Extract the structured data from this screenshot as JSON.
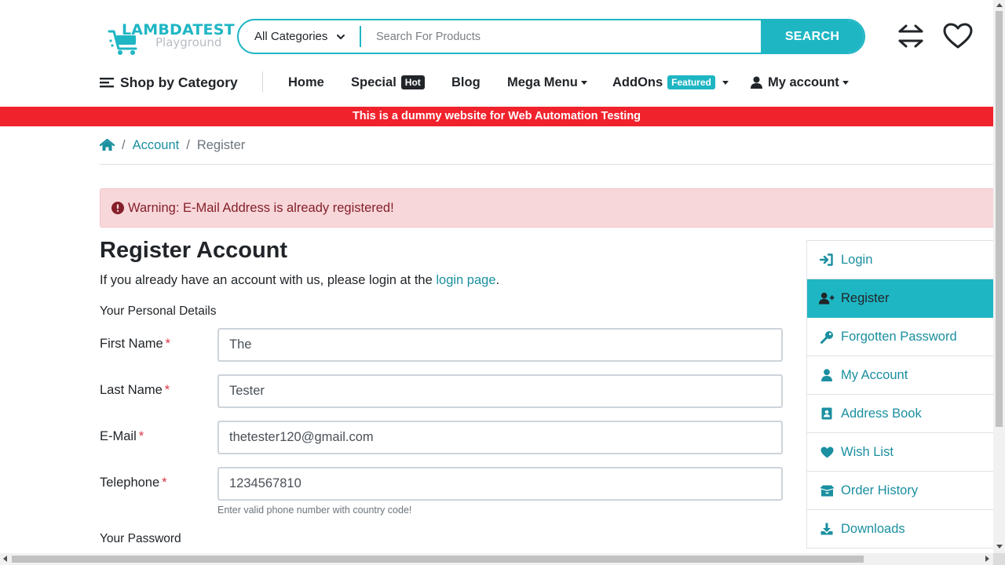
{
  "brand": {
    "name": "LAMBDATEST",
    "sub": "Playground"
  },
  "search": {
    "category": "All Categories",
    "placeholder": "Search For Products",
    "button": "SEARCH"
  },
  "header_icons": [
    "compare-icon",
    "wishlist-heart-icon"
  ],
  "nav": {
    "shop_by_category": "Shop by Category",
    "home": "Home",
    "special": "Special",
    "special_badge": "Hot",
    "blog": "Blog",
    "mega_menu": "Mega Menu",
    "addons": "AddOns",
    "addons_badge": "Featured",
    "my_account": "My account"
  },
  "colors": {
    "accent": "#1fb6c4",
    "banner": "#f0222c",
    "hot_badge": "#212529",
    "link": "#1a8fa0",
    "warning_bg": "#f8d7da",
    "warning_text": "#842029"
  },
  "banner": "This is a dummy website for Web Automation Testing",
  "breadcrumb": {
    "sep": "/",
    "account": "Account",
    "current": "Register"
  },
  "alert": "Warning: E-Mail Address is already registered!",
  "page": {
    "title": "Register Account",
    "intro_prefix": "If you already have an account with us, please login at the ",
    "intro_link": "login page",
    "intro_suffix": ".",
    "personal_legend": "Your Personal Details",
    "password_legend": "Your Password"
  },
  "form": {
    "required_mark": "*",
    "first_name": {
      "label": "First Name",
      "value": "The"
    },
    "last_name": {
      "label": "Last Name",
      "value": "Tester"
    },
    "email": {
      "label": "E-Mail",
      "value": "thetester120@gmail.com"
    },
    "telephone": {
      "label": "Telephone",
      "value": "1234567810",
      "help": "Enter valid phone number with country code!"
    }
  },
  "sidebar": {
    "items": [
      {
        "label": "Login",
        "icon": "sign-in-icon"
      },
      {
        "label": "Register",
        "icon": "user-plus-icon",
        "active": true
      },
      {
        "label": "Forgotten Password",
        "icon": "key-icon"
      },
      {
        "label": "My Account",
        "icon": "user-icon"
      },
      {
        "label": "Address Book",
        "icon": "address-book-icon"
      },
      {
        "label": "Wish List",
        "icon": "heart-icon"
      },
      {
        "label": "Order History",
        "icon": "order-history-icon"
      },
      {
        "label": "Downloads",
        "icon": "download-icon"
      }
    ]
  }
}
